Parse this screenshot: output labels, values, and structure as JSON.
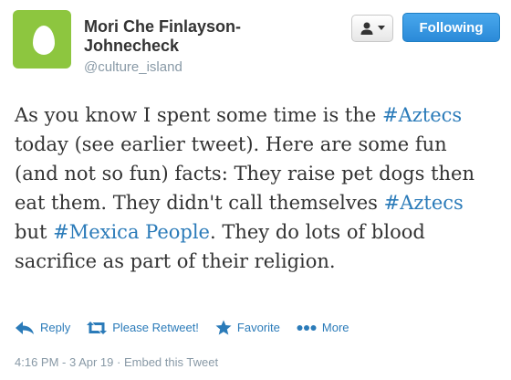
{
  "tweet": {
    "author_name": "Mori Che Finlayson-Johnecheck",
    "handle": "@culture_island",
    "follow_label": "Following",
    "text": {
      "p1": "As you know I spent some time is the ",
      "h1": "#Aztecs",
      "p2": " today (see earlier tweet). Here are some fun (and not so fun) facts: They raise pet dogs then eat them. They didn't call themselves ",
      "h2": "#Aztecs",
      "p3": " but ",
      "h3": "#Mexica People",
      "p4": ". They do lots of blood sacrifice as part of their religion."
    },
    "actions": {
      "reply": "Reply",
      "retweet": "Please Retweet!",
      "favorite": "Favorite",
      "more": "More"
    },
    "timestamp": "4:16 PM - 3 Apr 19",
    "separator": " · ",
    "embed": "Embed this Tweet"
  },
  "icons": {
    "avatar": "default-egg-avatar",
    "user_menu": "person-icon",
    "reply": "reply-arrow-icon",
    "retweet": "retweet-icon",
    "favorite": "star-icon",
    "more": "ellipsis-icon"
  },
  "colors": {
    "link": "#2b7bb9",
    "follow_button": "#2b8ad8",
    "avatar_bg": "#8dc63f",
    "meta": "#8899a6"
  }
}
